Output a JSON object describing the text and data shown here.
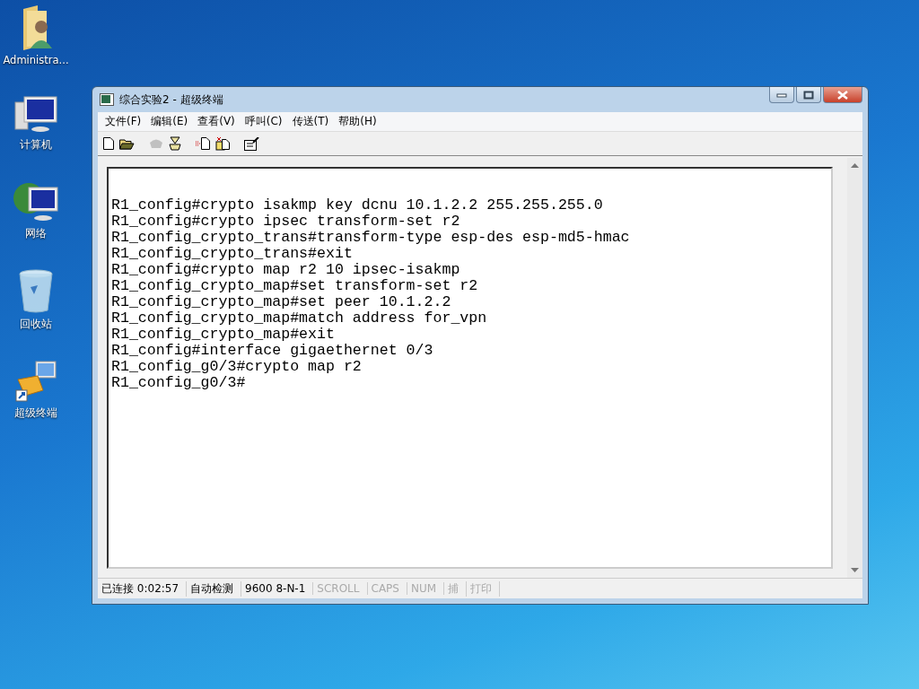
{
  "desktop_icons": [
    {
      "kind": "user-folder",
      "label": "Administra..."
    },
    {
      "kind": "computer",
      "label": "计算机"
    },
    {
      "kind": "network",
      "label": "网络"
    },
    {
      "kind": "recycle-bin",
      "label": "回收站"
    },
    {
      "kind": "terminal-shortcut",
      "label": "超级终端"
    }
  ],
  "window": {
    "title": "综合实验2 - 超级终端"
  },
  "menu": [
    "文件(F)",
    "编辑(E)",
    "查看(V)",
    "呼叫(C)",
    "传送(T)",
    "帮助(H)"
  ],
  "toolbar": [
    {
      "kind": "new",
      "disabled": false
    },
    {
      "kind": "open",
      "disabled": false
    },
    {
      "kind": "call",
      "disabled": true
    },
    {
      "kind": "hangup",
      "disabled": false
    },
    {
      "kind": "send",
      "disabled": false
    },
    {
      "kind": "receive",
      "disabled": false
    },
    {
      "kind": "properties",
      "disabled": false
    }
  ],
  "terminal_lines": [
    "R1_config#crypto isakmp key dcnu 10.1.2.2 255.255.255.0",
    "R1_config#crypto ipsec transform-set r2",
    "R1_config_crypto_trans#transform-type esp-des esp-md5-hmac",
    "R1_config_crypto_trans#exit",
    "R1_config#crypto map r2 10 ipsec-isakmp",
    "R1_config_crypto_map#set transform-set r2",
    "R1_config_crypto_map#set peer 10.1.2.2",
    "R1_config_crypto_map#match address for_vpn",
    "R1_config_crypto_map#exit",
    "R1_config#interface gigaethernet 0/3",
    "R1_config_g0/3#crypto map r2",
    "R1_config_g0/3#"
  ],
  "status_bar": [
    {
      "text": "已连接 0:02:57",
      "disabled": false
    },
    {
      "text": "自动检测",
      "disabled": false
    },
    {
      "text": "9600 8-N-1",
      "disabled": false
    },
    {
      "text": "SCROLL",
      "disabled": true
    },
    {
      "text": "CAPS",
      "disabled": true
    },
    {
      "text": "NUM",
      "disabled": true
    },
    {
      "text": "捕",
      "disabled": true
    },
    {
      "text": "打印",
      "disabled": true
    }
  ]
}
